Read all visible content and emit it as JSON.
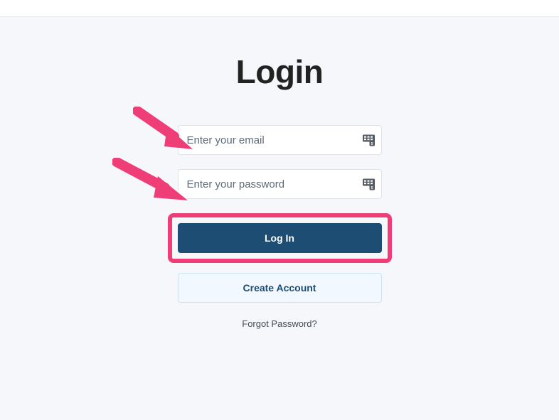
{
  "page": {
    "title": "Login"
  },
  "fields": {
    "email": {
      "placeholder": "Enter your email"
    },
    "password": {
      "placeholder": "Enter your password"
    }
  },
  "buttons": {
    "login_label": "Log In",
    "create_account_label": "Create Account"
  },
  "links": {
    "forgot_password_label": "Forgot Password?"
  },
  "colors": {
    "accent": "#1d4d73",
    "highlight": "#ef3d77",
    "page_bg": "#f5f7fa"
  },
  "annotations": {
    "arrow_email": true,
    "arrow_password": true,
    "highlight_login_button": true
  }
}
